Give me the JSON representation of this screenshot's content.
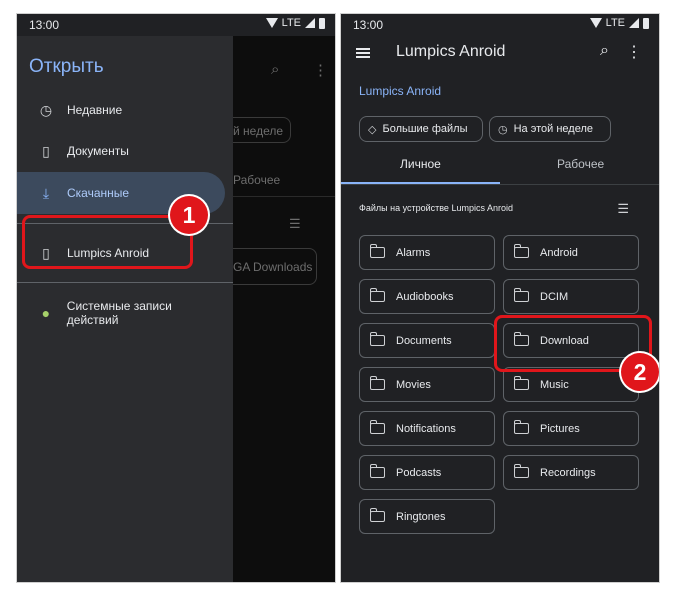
{
  "status": {
    "time": "13:00",
    "network": "LTE"
  },
  "left": {
    "drawer_title": "Открыть",
    "items": [
      {
        "label": "Недавние",
        "icon": "clock-icon"
      },
      {
        "label": "Документы",
        "icon": "document-icon"
      },
      {
        "label": "Скачанные",
        "icon": "download-icon"
      },
      {
        "label": "Lumpics Anroid",
        "icon": "phone-icon"
      },
      {
        "label": "Системные записи действий",
        "icon": "android-icon"
      }
    ],
    "background": {
      "chip": "й неделе",
      "tab": "Рабочее",
      "folder": "GA Downloads"
    },
    "badge": "1"
  },
  "right": {
    "title": "Lumpics Anroid",
    "breadcrumb": "Lumpics Anroid",
    "chips": [
      "Большие файлы",
      "На этой неделе"
    ],
    "tabs": [
      "Личное",
      "Рабочее"
    ],
    "section": "Файлы на устройстве Lumpics Anroid",
    "folders": [
      "Alarms",
      "Android",
      "Audiobooks",
      "DCIM",
      "Documents",
      "Download",
      "Movies",
      "Music",
      "Notifications",
      "Pictures",
      "Podcasts",
      "Recordings",
      "Ringtones"
    ],
    "badge": "2"
  },
  "colors": {
    "accent": "#8ab4f8",
    "highlight": "#e0161b",
    "background": "#202124"
  }
}
